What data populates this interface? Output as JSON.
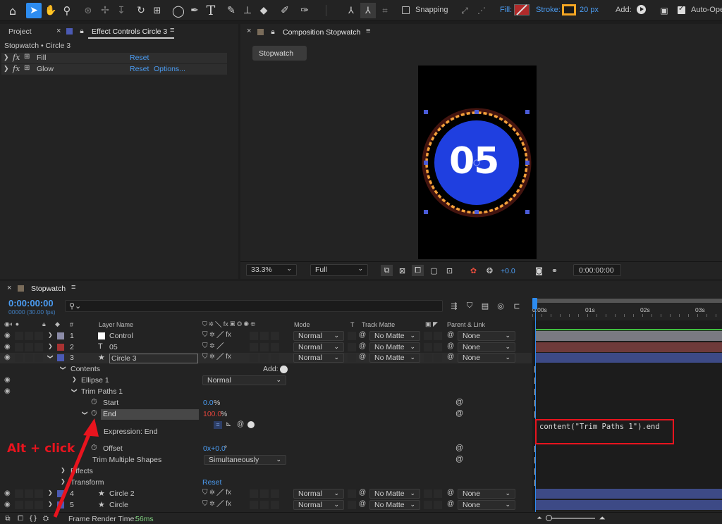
{
  "toolbar": {
    "snapping_label": "Snapping",
    "fill_label": "Fill:",
    "stroke_label": "Stroke:",
    "stroke_width": "20 px",
    "add_label": "Add:",
    "auto_open_label": "Auto-Ope"
  },
  "left_panel": {
    "tab_project": "Project",
    "tab_effect_controls": "Effect Controls Circle 3",
    "breadcrumb": "Stopwatch • Circle 3",
    "effects": [
      {
        "name": "Fill",
        "reset": "Reset",
        "options": ""
      },
      {
        "name": "Glow",
        "reset": "Reset",
        "options": "Options..."
      }
    ]
  },
  "composition": {
    "tab_label": "Composition Stopwatch",
    "sub_tab": "Stopwatch",
    "display_number": "05",
    "zoom": "33.3%",
    "resolution": "Full",
    "exposure": "+0.0",
    "timecode": "0:00:00:00"
  },
  "timeline": {
    "tab_label": "Stopwatch",
    "timecode": "0:00:00:00",
    "frame_info": "00000 (30.00 fps)",
    "search_placeholder": "",
    "col_number": "#",
    "col_layer_name": "Layer Name",
    "col_mode": "Mode",
    "col_t": "T",
    "col_track_matte": "Track Matte",
    "col_parent": "Parent & Link",
    "ruler": [
      "0:00s",
      "01s",
      "02s",
      "03s"
    ],
    "layers": [
      {
        "num": "1",
        "name": "Control",
        "mode": "Normal",
        "matte": "No Matte",
        "parent": "None",
        "color": "#8c8ca8",
        "track": "#7a7a82"
      },
      {
        "num": "2",
        "name": "05",
        "mode": "Normal",
        "matte": "No Matte",
        "parent": "None",
        "color": "#a83232",
        "track": "#6e3a3a"
      },
      {
        "num": "3",
        "name": "Circle 3",
        "mode": "Normal",
        "matte": "No Matte",
        "parent": "None",
        "color": "#4b5ab4",
        "track": "#3d4a86"
      }
    ],
    "layers_bottom": [
      {
        "num": "4",
        "name": "Circle 2",
        "mode": "Normal",
        "matte": "No Matte",
        "parent": "None",
        "color": "#4b5ab4",
        "track": "#3d4a86"
      },
      {
        "num": "5",
        "name": "Circle",
        "mode": "Normal",
        "matte": "No Matte",
        "parent": "None",
        "color": "#4b5ab4",
        "track": "#3d4a86"
      }
    ],
    "contents_label": "Contents",
    "add_label": "Add:",
    "ellipse_label": "Ellipse 1",
    "ellipse_mode": "Normal",
    "trim_paths_label": "Trim Paths 1",
    "start_label": "Start",
    "start_value": "0.0",
    "start_unit": "%",
    "end_label": "End",
    "end_value": "100.0",
    "end_unit": "%",
    "expression_label": "Expression: End",
    "expression_code": "content(\"Trim Paths 1\").end",
    "offset_label": "Offset",
    "offset_value": "0x+0.0",
    "offset_unit": "°",
    "trim_multiple_label": "Trim Multiple Shapes",
    "trim_multiple_value": "Simultaneously",
    "effects_label": "Effects",
    "transform_label": "Transform",
    "transform_reset": "Reset",
    "frame_render_label": "Frame Render Time:",
    "frame_render_value": "56ms"
  },
  "annotation": {
    "text": "Alt + click"
  },
  "colors": {
    "accent_blue": "#4b9cf2",
    "selection_blue": "#2d8cf0",
    "annotation_red": "#e8141e",
    "stopwatch_fill": "#1f3fe0",
    "dash_orange": "#f5a13a"
  }
}
